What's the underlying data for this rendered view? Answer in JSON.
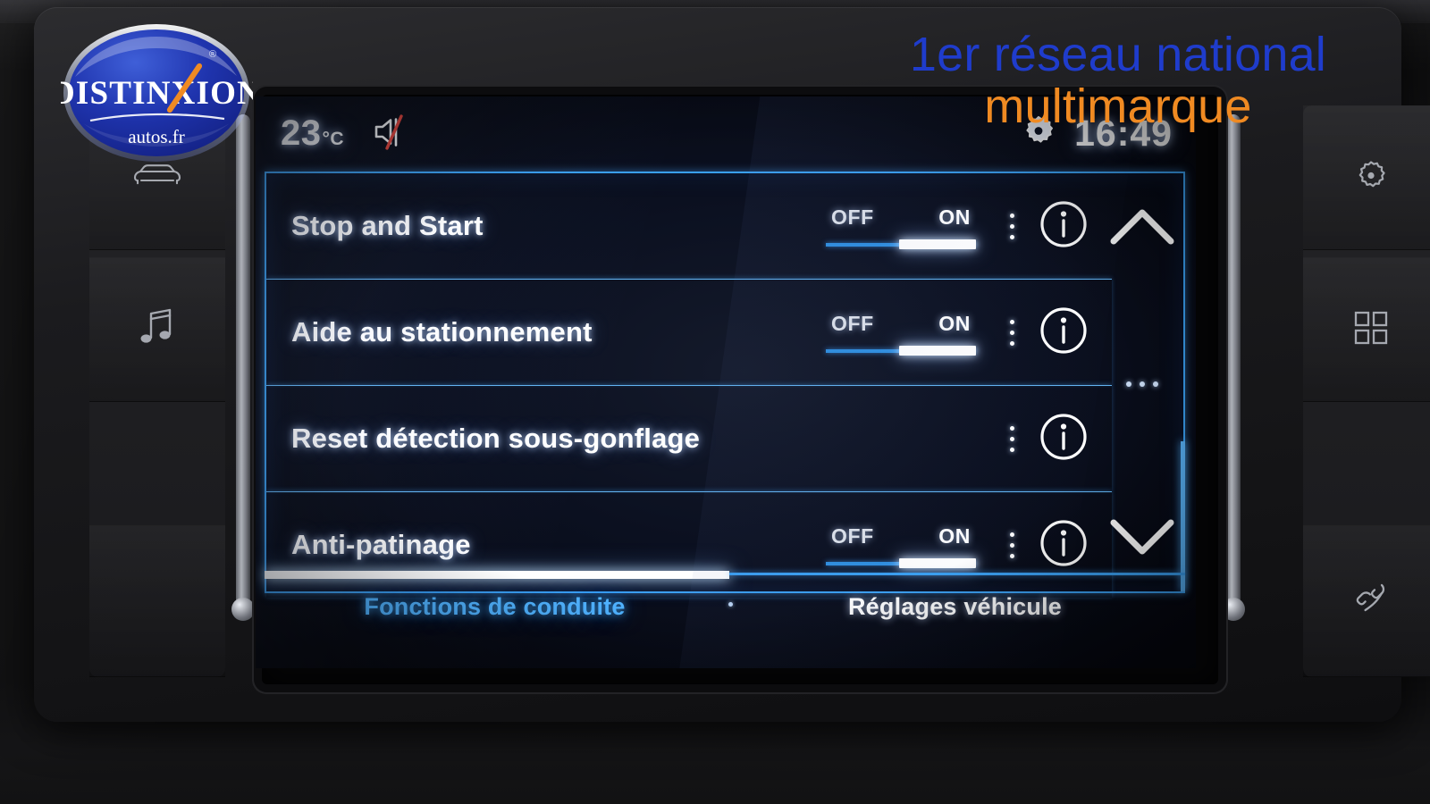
{
  "watermark": {
    "line1": "1er réseau national",
    "line2": "multimarque",
    "line1_color": "#1f3ccc",
    "line2_color": "#f08a22",
    "logo_text": "DISTINXION",
    "logo_sub": "autos.fr",
    "logo_registered": "®"
  },
  "screen": {
    "status": {
      "temperature": "23",
      "temperature_unit": "°C",
      "mute_icon": "speaker-muted-icon",
      "settings_icon": "gear-icon",
      "clock": "16:49"
    },
    "list": {
      "rows": [
        {
          "label": "Stop and Start",
          "has_toggle": true,
          "off_label": "OFF",
          "on_label": "ON",
          "selected": "ON",
          "menu_icon": "vertical-dots-icon",
          "info_icon": "info-circle-icon"
        },
        {
          "label": "Aide au stationnement",
          "has_toggle": true,
          "off_label": "OFF",
          "on_label": "ON",
          "selected": "ON",
          "menu_icon": "vertical-dots-icon",
          "info_icon": "info-circle-icon"
        },
        {
          "label": "Reset détection sous-gonflage",
          "has_toggle": false,
          "off_label": "",
          "on_label": "",
          "selected": "",
          "menu_icon": "vertical-dots-icon",
          "info_icon": "info-circle-icon"
        },
        {
          "label": "Anti-patinage",
          "has_toggle": true,
          "off_label": "OFF",
          "on_label": "ON",
          "selected": "ON",
          "menu_icon": "vertical-dots-icon",
          "info_icon": "info-circle-icon"
        }
      ]
    },
    "scroll": {
      "up_icon": "chevron-up-icon",
      "middle_icon": "horizontal-dots-icon",
      "down_icon": "chevron-down-icon"
    },
    "tabs": [
      {
        "label": "Fonctions de conduite",
        "active": true
      },
      {
        "label": "Réglages véhicule",
        "active": false
      }
    ],
    "colors": {
      "accent_blue": "#3a9ff0",
      "active_tab_blue": "#4fb2ff",
      "highlight_white": "#ffffff",
      "panel_bg": "#0b1020"
    }
  },
  "hardware": {
    "left_buttons": [
      {
        "icon": "car-front-icon"
      },
      {
        "icon": "music-note-icon"
      },
      {
        "icon": "blank-button"
      }
    ],
    "right_buttons": [
      {
        "icon": "gear-icon"
      },
      {
        "icon": "apps-grid-icon"
      },
      {
        "icon": "phone-handset-icon"
      }
    ]
  }
}
